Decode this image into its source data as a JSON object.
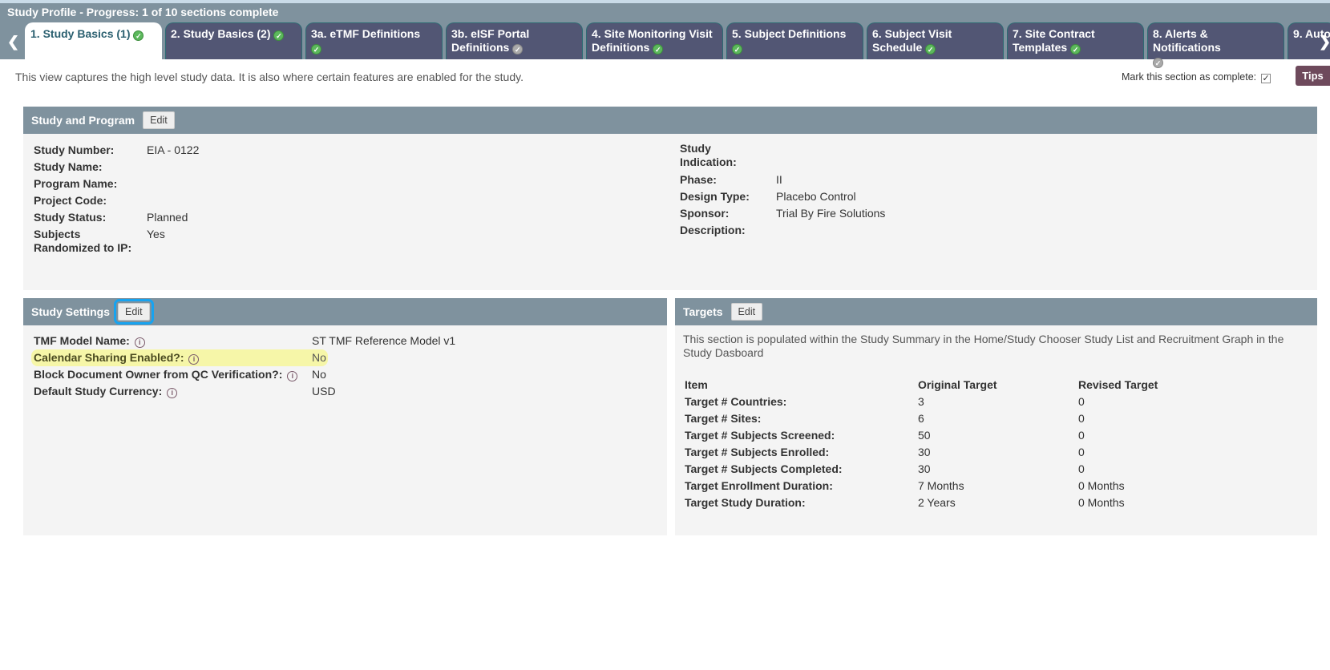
{
  "header": {
    "title": "Study Profile - Progress: 1 of 10 sections complete"
  },
  "tabs": [
    {
      "label": "1. Study Basics (1)",
      "status": "complete",
      "active": true
    },
    {
      "label": "2. Study Basics (2)",
      "status": "complete"
    },
    {
      "label": "3a. eTMF Definitions",
      "status": "complete"
    },
    {
      "label": "3b. eISF Portal Definitions",
      "status": "incomplete"
    },
    {
      "label": "4. Site Monitoring Visit Definitions",
      "status": "complete"
    },
    {
      "label": "5. Subject Definitions",
      "status": "complete"
    },
    {
      "label": "6. Subject Visit Schedule",
      "status": "complete"
    },
    {
      "label": "7. Site Contract Templates",
      "status": "complete"
    },
    {
      "label": "8. Alerts & Notifications",
      "status": "incomplete"
    },
    {
      "label": "9. Auto",
      "status": "unknown"
    }
  ],
  "nav": {
    "prev": "❮",
    "next": "❯"
  },
  "description": "This view captures the high level study data. It is also where certain features are enabled for the study.",
  "mark_complete": {
    "label": "Mark this section as complete:",
    "checked": true
  },
  "tips_label": "Tips",
  "edit_label": "Edit",
  "study_program": {
    "title": "Study and Program",
    "left": [
      {
        "label": "Study Number:",
        "value": "EIA - 0122"
      },
      {
        "label": "Study Name:",
        "value": ""
      },
      {
        "label": "Program Name:",
        "value": ""
      },
      {
        "label": "Project Code:",
        "value": ""
      },
      {
        "label": "Study Status:",
        "value": "Planned"
      },
      {
        "label": "Subjects Randomized to IP:",
        "value": "Yes"
      }
    ],
    "right": [
      {
        "label": "Study Indication:",
        "value": ""
      },
      {
        "label": "Phase:",
        "value": "II"
      },
      {
        "label": "Design Type:",
        "value": "Placebo Control"
      },
      {
        "label": "Sponsor:",
        "value": "Trial By Fire Solutions"
      },
      {
        "label": "Description:",
        "value": ""
      }
    ]
  },
  "study_settings": {
    "title": "Study Settings",
    "rows": [
      {
        "label": "TMF Model Name:",
        "value": "ST TMF Reference Model v1"
      },
      {
        "label": "Calendar Sharing Enabled?:",
        "value": "No"
      },
      {
        "label": "Block Document Owner from QC Verification?:",
        "value": "No"
      },
      {
        "label": "Default Study Currency:",
        "value": "USD"
      }
    ]
  },
  "targets": {
    "title": "Targets",
    "note": "This section is populated within the Study Summary in the Home/Study Chooser Study List and Recruitment Graph in the Study Dasboard",
    "columns": [
      "Item",
      "Original Target",
      "Revised Target"
    ],
    "rows": [
      [
        "Target # Countries:",
        "3",
        "0"
      ],
      [
        "Target # Sites:",
        "6",
        "0"
      ],
      [
        "Target # Subjects Screened:",
        "50",
        "0"
      ],
      [
        "Target # Subjects Enrolled:",
        "30",
        "0"
      ],
      [
        "Target # Subjects Completed:",
        "30",
        "0"
      ],
      [
        "Target Enrollment Duration:",
        "7 Months",
        "0 Months"
      ],
      [
        "Target Study Duration:",
        "2 Years",
        "0 Months"
      ]
    ]
  },
  "colors": {
    "header": "#7f929e",
    "tab": "#525674",
    "active_tab_text": "#2b6070",
    "highlight": "#f6f6a8",
    "tips": "#6e4a5c",
    "focus": "#17a3f0"
  }
}
